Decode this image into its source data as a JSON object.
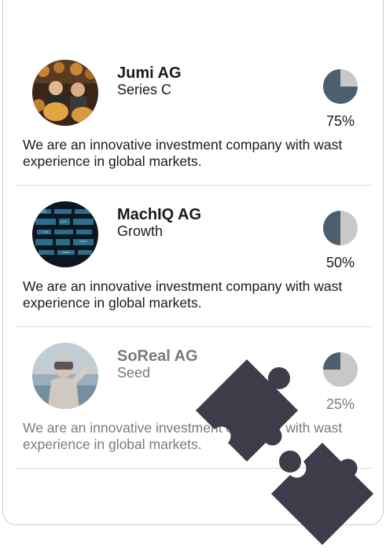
{
  "companies": [
    {
      "name": "Jumi AG",
      "stage": "Series C",
      "progress_percent": 75,
      "progress_label": "75%",
      "description": "We are an innovative investment company with wast experience in global markets.",
      "avatar_icon": "cheese-makers-photo"
    },
    {
      "name": "MachIQ AG",
      "stage": "Growth",
      "progress_percent": 50,
      "progress_label": "50%",
      "description": "We are an innovative investment company with wast experience in global markets.",
      "avatar_icon": "server-dashboard-photo"
    },
    {
      "name": "SoReal AG",
      "stage": "Seed",
      "progress_percent": 25,
      "progress_label": "25%",
      "description": "We are an innovative investment company with wast experience in global markets.",
      "avatar_icon": "vr-headset-photo"
    }
  ],
  "colors": {
    "pie_filled": "#4a5f70",
    "pie_empty": "#c8c8c8",
    "puzzle": "#3c3d48"
  },
  "overlay_icon": "puzzle-pieces-icon"
}
